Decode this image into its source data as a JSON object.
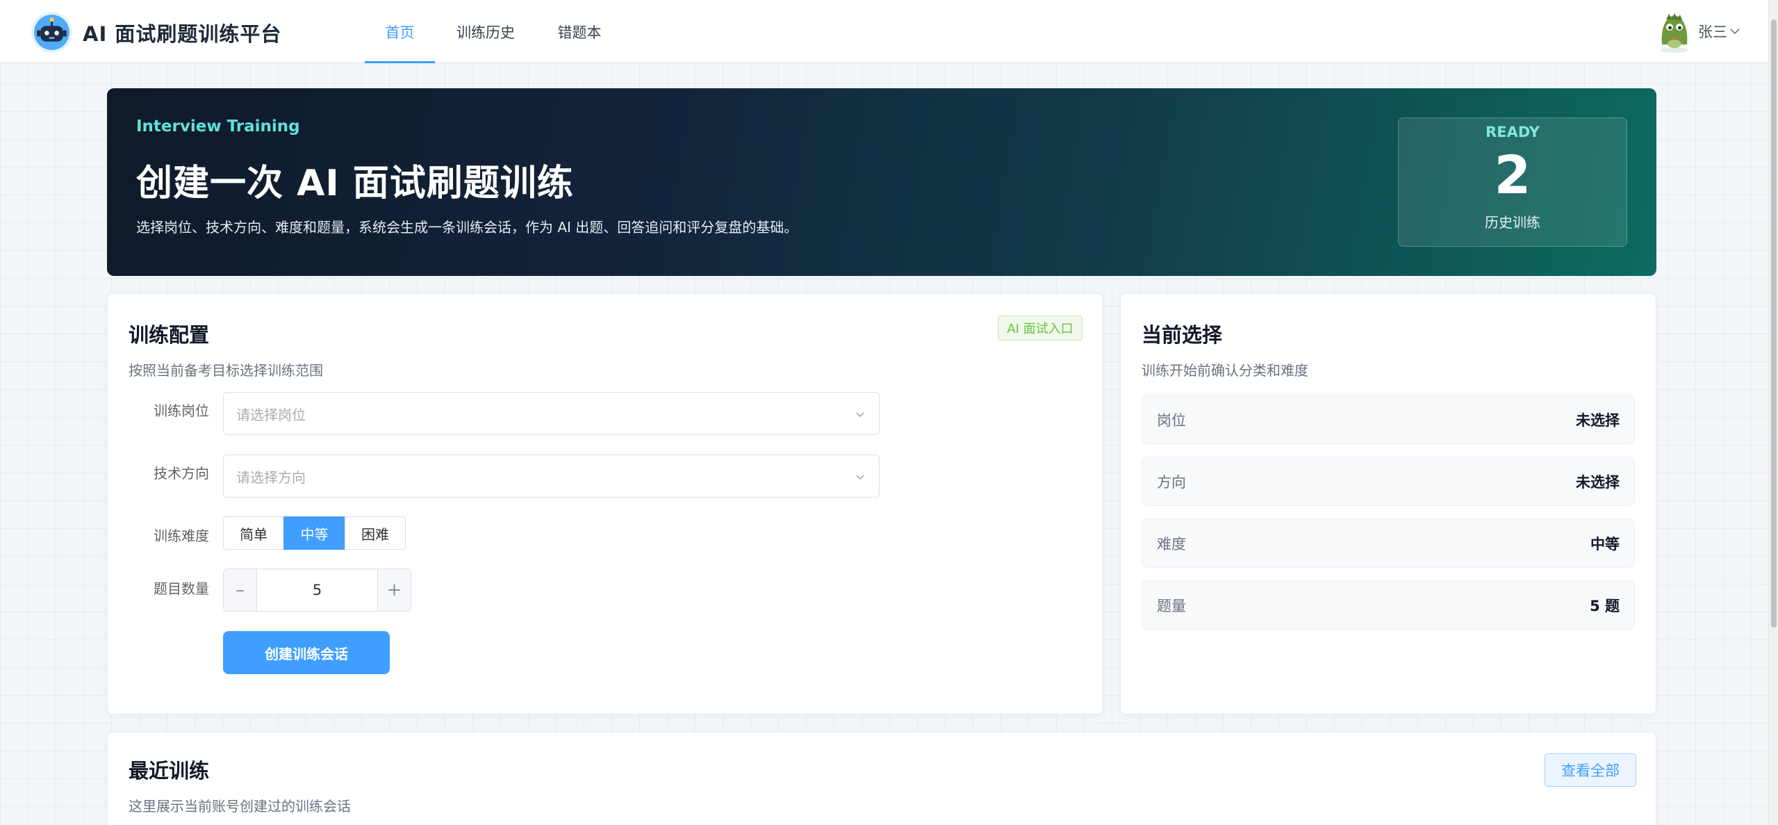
{
  "header": {
    "brand_title": "AI 面试刷题训练平台",
    "nav": [
      {
        "label": "首页",
        "active": true
      },
      {
        "label": "训练历史",
        "active": false
      },
      {
        "label": "错题本",
        "active": false
      }
    ],
    "user_name": "张三"
  },
  "hero": {
    "eyebrow": "Interview Training",
    "title": "创建一次 AI 面试刷题训练",
    "description": "选择岗位、技术方向、难度和题量，系统会生成一条训练会话，作为 AI 出题、回答追问和评分复盘的基础。",
    "ready_tag": "READY",
    "ready_count": "2",
    "ready_label": "历史训练"
  },
  "config": {
    "title": "训练配置",
    "subtitle": "按照当前备考目标选择训练范围",
    "tag": "AI 面试入口",
    "position_label": "训练岗位",
    "position_placeholder": "请选择岗位",
    "direction_label": "技术方向",
    "direction_placeholder": "请选择方向",
    "difficulty_label": "训练难度",
    "difficulty_options": [
      "简单",
      "中等",
      "困难"
    ],
    "difficulty_selected": "中等",
    "count_label": "题目数量",
    "count_value": "5",
    "minus_symbol": "–",
    "plus_symbol": "+",
    "create_button": "创建训练会话"
  },
  "selection": {
    "title": "当前选择",
    "subtitle": "训练开始前确认分类和难度",
    "rows": [
      {
        "key": "岗位",
        "value": "未选择"
      },
      {
        "key": "方向",
        "value": "未选择"
      },
      {
        "key": "难度",
        "value": "中等"
      },
      {
        "key": "题量",
        "value": "5 题"
      }
    ]
  },
  "recent": {
    "title": "最近训练",
    "subtitle": "这里展示当前账号创建过的训练会话",
    "view_all": "查看全部"
  },
  "colors": {
    "primary": "#409eff",
    "success": "#67c23a",
    "hero_accent": "#5ee3d6"
  },
  "icons": {
    "brand": "robot-icon",
    "avatar": "dinosaur-avatar",
    "user_menu": "chevron-down-icon",
    "select": "chevron-down-icon"
  }
}
